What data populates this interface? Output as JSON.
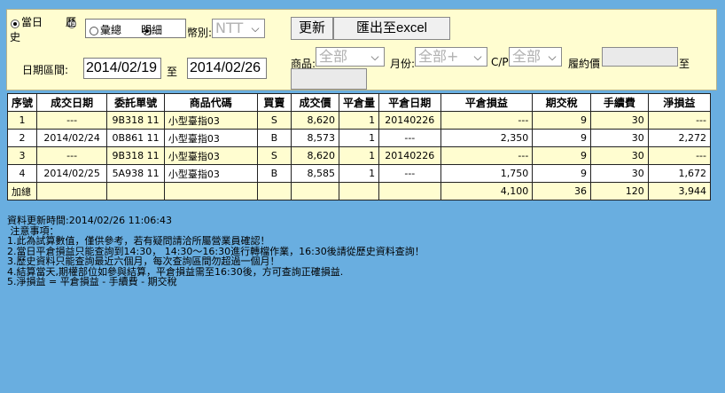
{
  "header": {
    "mode_options": {
      "today": "當日",
      "history": "歷",
      "history_wrap": "史"
    },
    "detail_options": {
      "summary": "彙總",
      "detail": "明細"
    },
    "currency_label": "幣別:",
    "currency_value": "NTT",
    "refresh_label": "更新",
    "export_label": "匯出至excel",
    "date_range_label": "日期區間:",
    "date_from": "2014/02/19",
    "to_label": "至",
    "date_to": "2014/02/26",
    "product_label": "商品:",
    "product_value": "全部",
    "month_label": "月份:",
    "month_value": "全部+",
    "cp_label": "C/P",
    "cp_value": "全部",
    "strike_label": "履約價",
    "strike_to_label": "至"
  },
  "table": {
    "columns": [
      "序號",
      "成交日期",
      "委託單號",
      "商品代碼",
      "買賣",
      "成交價",
      "平倉量",
      "平倉日期",
      "平倉損益",
      "期交稅",
      "手續費",
      "淨損益"
    ],
    "rows": [
      [
        "1",
        "---",
        "9B318 11",
        "小型臺指03",
        "S",
        "8,620",
        "1",
        "20140226",
        "---",
        "9",
        "30",
        "---"
      ],
      [
        "2",
        "2014/02/24",
        "0B861 11",
        "小型臺指03",
        "B",
        "8,573",
        "1",
        "---",
        "2,350",
        "9",
        "30",
        "2,272"
      ],
      [
        "3",
        "---",
        "9B318 11",
        "小型臺指03",
        "S",
        "8,620",
        "1",
        "20140226",
        "---",
        "9",
        "30",
        "---"
      ],
      [
        "4",
        "2014/02/25",
        "5A938 11",
        "小型臺指03",
        "B",
        "8,585",
        "1",
        "---",
        "1,750",
        "9",
        "30",
        "1,672"
      ]
    ],
    "total": [
      "加總",
      "",
      "",
      "",
      "",
      "",
      "",
      "",
      "4,100",
      "36",
      "120",
      "3,944"
    ]
  },
  "notes": {
    "updated": "資料更新時間:2014/02/26 11:06:43",
    "title": " 注意事項：",
    "items": [
      "1.此為試算數值，僅供參考，若有疑問請洽所屬營業員確認！",
      "2.當日平倉損益只能查詢到14:30， 14:30～16:30進行轉檔作業，16:30後請從歷史資料查詢！",
      "3.歷史資料只能查詢最近六個月，每次查詢區間勿超過一個月！",
      "4.結算當天,期權部位如參與結算，平倉損益需至16:30後，方可查詢正確損益.",
      "5.淨損益 = 平倉損益 - 手續費 - 期交稅"
    ]
  },
  "colors": {
    "background": "#69aee0",
    "panel": "#fffdd0",
    "row_alt": "#fffdd0"
  }
}
